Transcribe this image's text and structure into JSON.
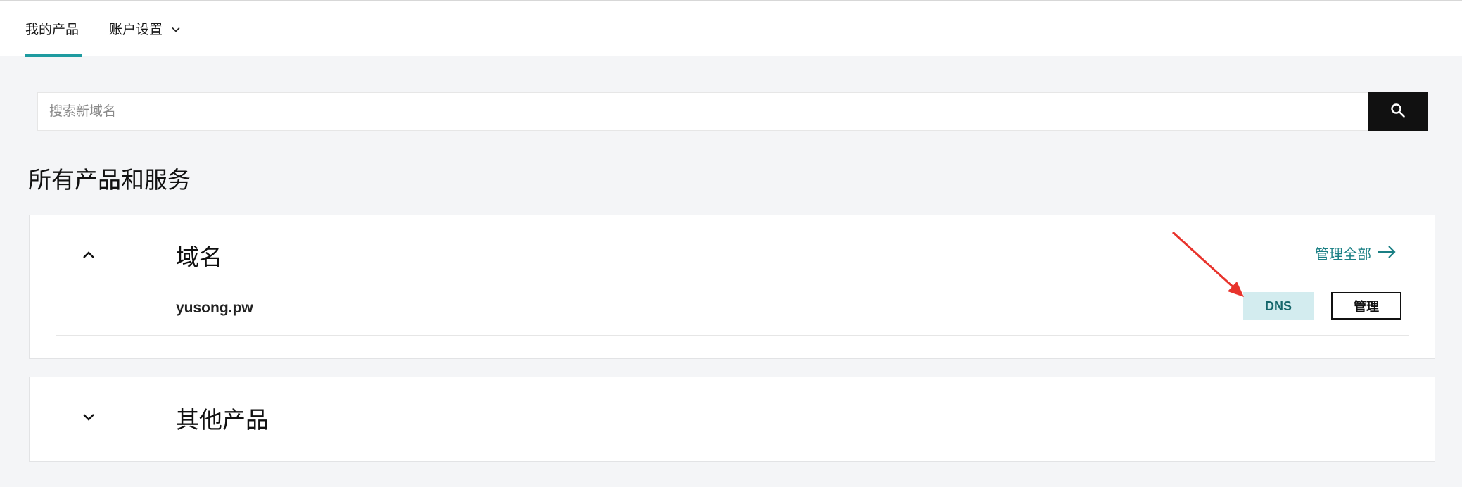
{
  "nav": {
    "tabs": [
      {
        "label": "我的产品",
        "active": true
      },
      {
        "label": "账户设置",
        "has_dropdown": true
      }
    ],
    "accent_color": "#1e9ba0"
  },
  "search": {
    "placeholder": "搜索新域名",
    "value": "",
    "button_icon": "search-icon"
  },
  "page": {
    "title": "所有产品和服务"
  },
  "sections": [
    {
      "title": "域名",
      "expanded": true,
      "toggle_icon": "chevron-up-icon",
      "manage_all_label": "管理全部",
      "manage_all_icon": "arrow-right-icon",
      "items": [
        {
          "name": "yusong.pw",
          "dns_label": "DNS",
          "manage_label": "管理"
        }
      ]
    },
    {
      "title": "其他产品",
      "expanded": false,
      "toggle_icon": "chevron-down-icon"
    }
  ],
  "colors": {
    "link": "#1a7f84",
    "dns_bg": "#d3ecef",
    "dns_text": "#16676c",
    "annotation_arrow": "#e8332c"
  }
}
